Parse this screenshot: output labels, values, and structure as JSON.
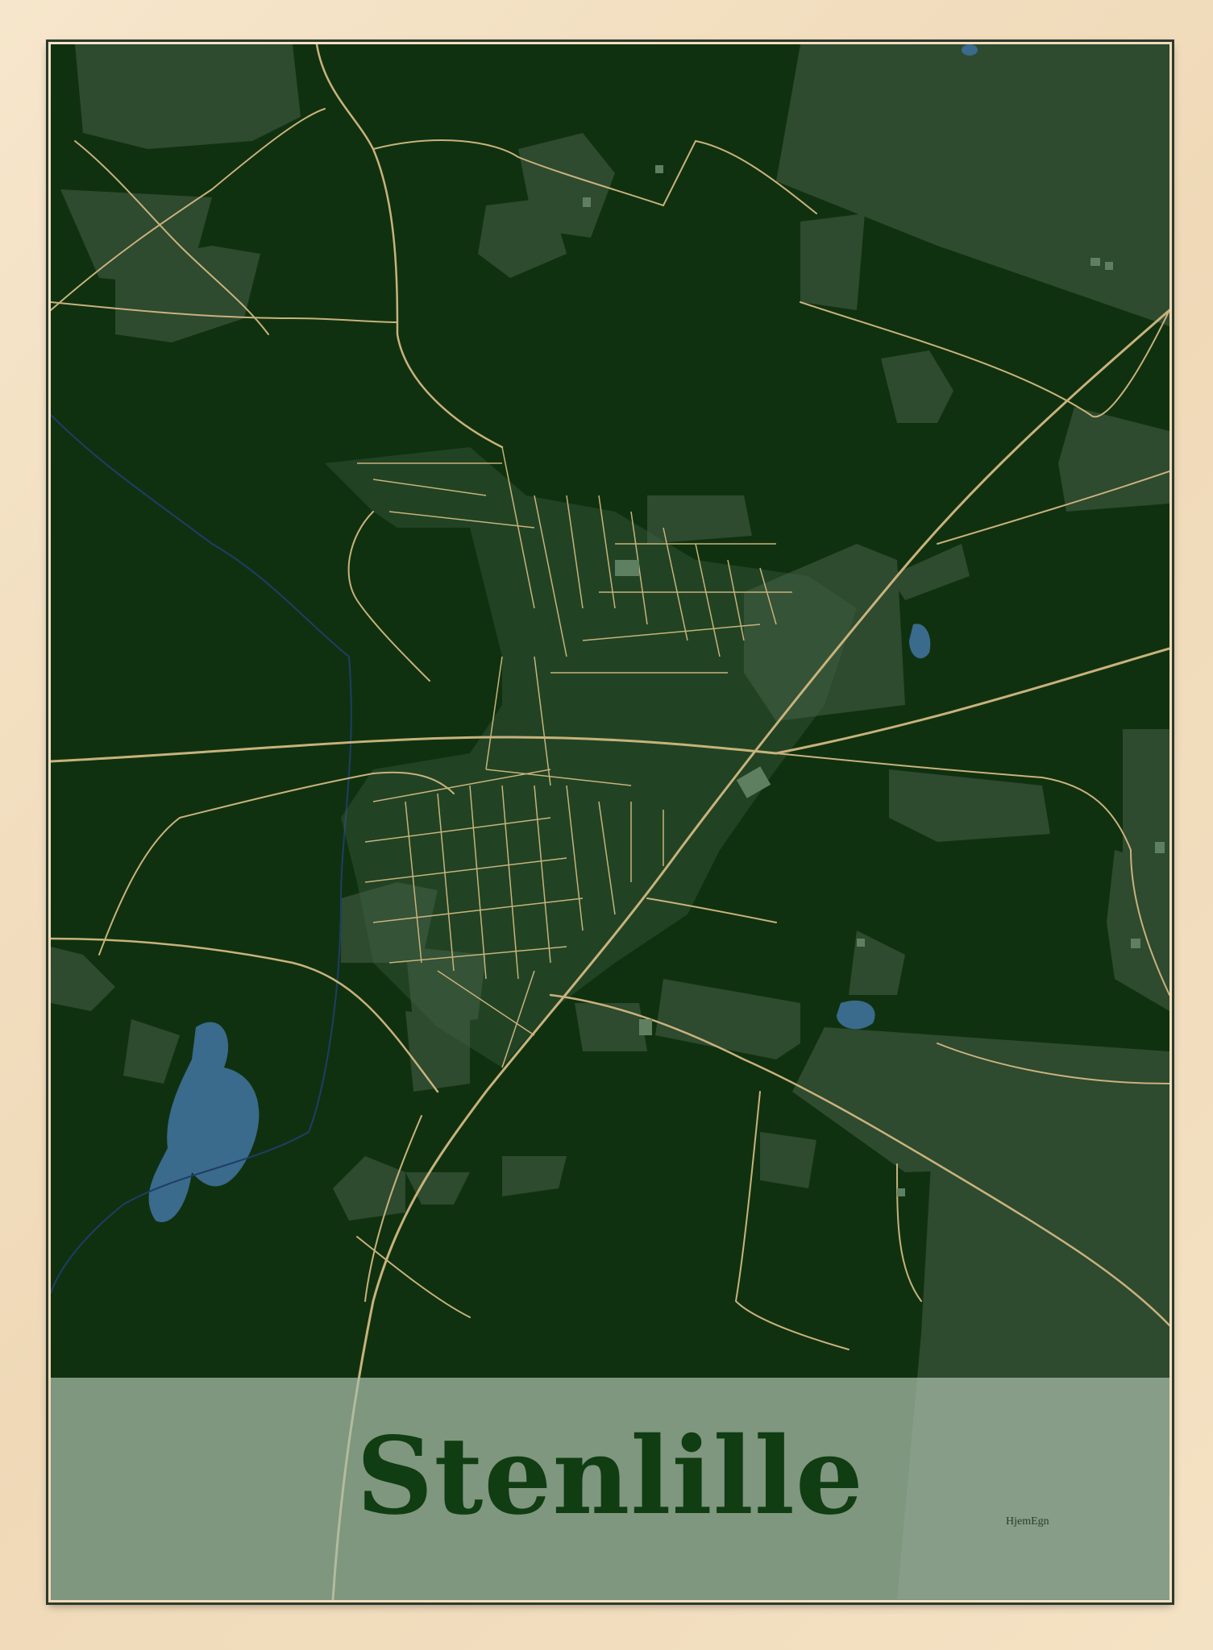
{
  "poster": {
    "title": "Stenlille",
    "brand": "HjemEgn"
  },
  "colors": {
    "frame_wood": "#f3e0c2",
    "map_background": "#10310f",
    "field_patch": "#2e4a2f",
    "roads": "#c8b27c",
    "water": "#3a6a8c",
    "title_band": "#aabeaa",
    "title_text": "#103d12"
  }
}
